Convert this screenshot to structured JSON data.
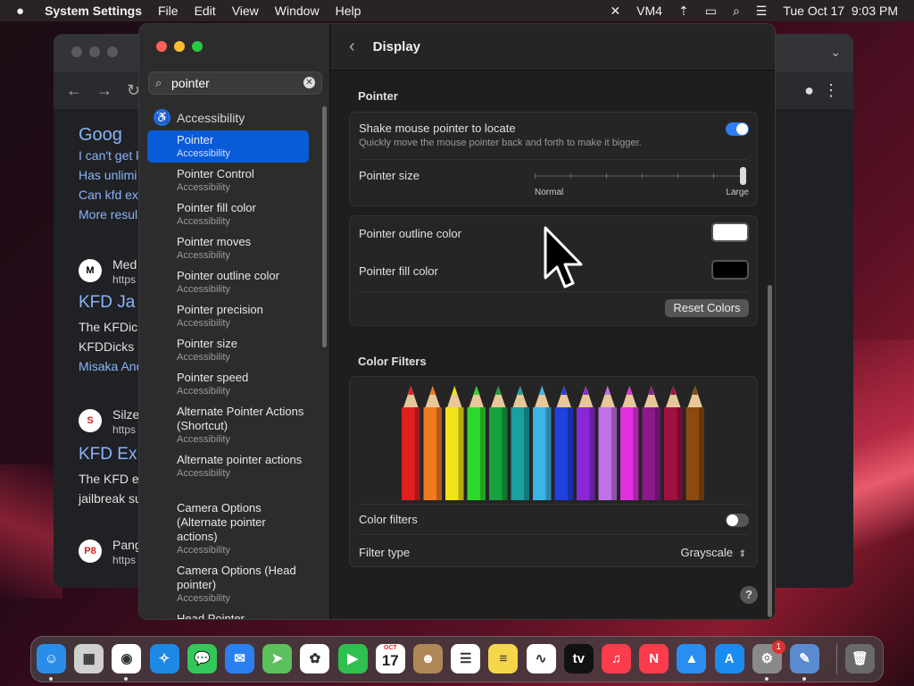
{
  "menubar": {
    "apple_icon": "apple-icon",
    "app_name": "System Settings",
    "menus": [
      "File",
      "Edit",
      "View",
      "Window",
      "Help"
    ],
    "status": {
      "vm_label": "VM4",
      "datetime": "Tue Oct 17  9:03 PM"
    }
  },
  "browser": {
    "lines": [
      {
        "text": "I can't get k",
        "kind": "link"
      },
      {
        "text": "Has unlimi",
        "kind": "link"
      },
      {
        "text": "Can kfd ex",
        "kind": "link"
      },
      {
        "text": "More resul",
        "kind": "link"
      }
    ],
    "results": [
      {
        "icon_label": "M",
        "site": "Med",
        "url": "https",
        "title": "KFD Ja",
        "snippet1": "The KFDic",
        "snippet2": "KFDDicks",
        "snippet3": "Misaka And"
      },
      {
        "icon_label": "S",
        "site": "Silze",
        "url": "https",
        "title": "KFD Ex",
        "snippet1": "The KFD e",
        "snippet2": "jailbreak su"
      },
      {
        "icon_label": "P8",
        "site": "Pang",
        "url": "https"
      }
    ]
  },
  "sidebar": {
    "search_value": "pointer",
    "section_label": "Accessibility",
    "items": [
      {
        "title": "Pointer",
        "subtitle": "Accessibility",
        "selected": true
      },
      {
        "title": "Pointer Control",
        "subtitle": "Accessibility"
      },
      {
        "title": "Pointer fill color",
        "subtitle": "Accessibility"
      },
      {
        "title": "Pointer moves",
        "subtitle": "Accessibility"
      },
      {
        "title": "Pointer outline color",
        "subtitle": "Accessibility"
      },
      {
        "title": "Pointer precision",
        "subtitle": "Accessibility"
      },
      {
        "title": "Pointer size",
        "subtitle": "Accessibility"
      },
      {
        "title": "Pointer speed",
        "subtitle": "Accessibility"
      },
      {
        "title": "Alternate Pointer Actions (Shortcut)",
        "subtitle": "Accessibility"
      },
      {
        "title": "Alternate pointer actions",
        "subtitle": "Accessibility"
      },
      {
        "title": "Camera Options (Alternate pointer actions)",
        "subtitle": "Accessibility"
      },
      {
        "title": "Camera Options (Head pointer)",
        "subtitle": "Accessibility"
      },
      {
        "title": "Head Pointer",
        "subtitle": ""
      }
    ]
  },
  "main": {
    "title": "Display",
    "pointer_section": "Pointer",
    "shake_label": "Shake mouse pointer to locate",
    "shake_desc": "Quickly move the mouse pointer back and forth to make it bigger.",
    "shake_on": true,
    "size_label": "Pointer size",
    "size_min_label": "Normal",
    "size_max_label": "Large",
    "size_value_fraction": 1.0,
    "outline_label": "Pointer outline color",
    "outline_color": "#ffffff",
    "fill_label": "Pointer fill color",
    "fill_color": "#000000",
    "reset_label": "Reset Colors",
    "filters_section": "Color Filters",
    "pencil_colors": [
      "#e02020",
      "#f07a20",
      "#f2e21a",
      "#2ed82e",
      "#17a040",
      "#1aa0a0",
      "#3cb4e6",
      "#2040e0",
      "#8a28d8",
      "#c070e8",
      "#e030e0",
      "#8a1a8a",
      "#a01040",
      "#8a4a10"
    ],
    "filters_label": "Color filters",
    "filters_on": false,
    "filter_type_label": "Filter type",
    "filter_type_value": "Grayscale",
    "help_label": "?"
  },
  "dock": {
    "apps": [
      {
        "name": "finder-icon",
        "color": "#2a8ee8",
        "glyph": "☺",
        "running": true
      },
      {
        "name": "launchpad-icon",
        "color": "#d0d0d0",
        "glyph": "▦",
        "running": false
      },
      {
        "name": "chrome-icon",
        "color": "#ffffff",
        "glyph": "◉",
        "running": true
      },
      {
        "name": "safari-icon",
        "color": "#1e88e5",
        "glyph": "✧",
        "running": false
      },
      {
        "name": "messages-icon",
        "color": "#34c759",
        "glyph": "💬",
        "running": false
      },
      {
        "name": "mail-icon",
        "color": "#2a80f0",
        "glyph": "✉",
        "running": false
      },
      {
        "name": "maps-icon",
        "color": "#5cc05c",
        "glyph": "➤",
        "running": false
      },
      {
        "name": "photos-icon",
        "color": "#ffffff",
        "glyph": "✿",
        "running": false
      },
      {
        "name": "facetime-icon",
        "color": "#30c050",
        "glyph": "▶",
        "running": false
      },
      {
        "name": "calendar-icon",
        "color": "#ffffff",
        "glyph": "17",
        "running": false
      },
      {
        "name": "contacts-icon",
        "color": "#b08858",
        "glyph": "☻",
        "running": false
      },
      {
        "name": "reminders-icon",
        "color": "#ffffff",
        "glyph": "☰",
        "running": false
      },
      {
        "name": "notes-icon",
        "color": "#f5d64a",
        "glyph": "≡",
        "running": false
      },
      {
        "name": "freeform-icon",
        "color": "#ffffff",
        "glyph": "∿",
        "running": false
      },
      {
        "name": "tv-icon",
        "color": "#111111",
        "glyph": "tv",
        "running": false
      },
      {
        "name": "music-icon",
        "color": "#fa3c4c",
        "glyph": "♫",
        "running": false
      },
      {
        "name": "news-icon",
        "color": "#fa3c4c",
        "glyph": "N",
        "running": false
      },
      {
        "name": "keynote-icon",
        "color": "#2a8ef0",
        "glyph": "▲",
        "running": false
      },
      {
        "name": "app-store-icon",
        "color": "#1a8cf0",
        "glyph": "A",
        "running": false
      },
      {
        "name": "system-settings-icon",
        "color": "#8a8a8a",
        "glyph": "⚙",
        "running": true,
        "badge": "1"
      },
      {
        "name": "preview-icon",
        "color": "#5a8ad0",
        "glyph": "✎",
        "running": true
      },
      {
        "name": "trash-icon",
        "color": "#6a6a6a",
        "glyph": "🗑",
        "running": false
      }
    ],
    "calendar_month": "OCT"
  }
}
